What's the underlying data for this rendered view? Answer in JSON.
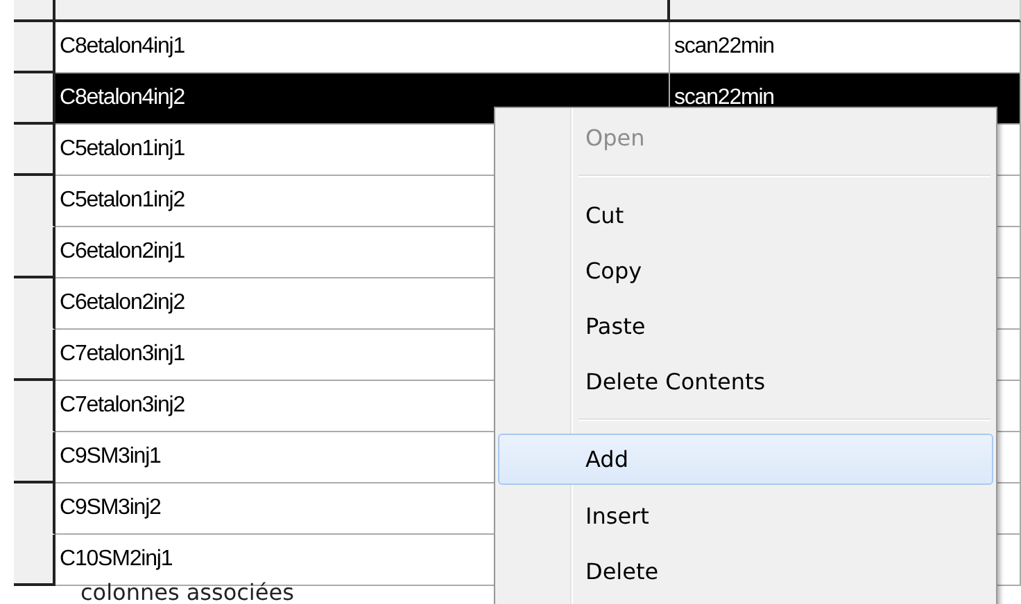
{
  "grid": {
    "rows": [
      {
        "cells": [
          "C8etalon4inj1",
          "scan22min"
        ],
        "selected": false
      },
      {
        "cells": [
          "C8etalon4inj2",
          "scan22min"
        ],
        "selected": true
      },
      {
        "cells": [
          "C5etalon1inj1"
        ],
        "selected": false
      },
      {
        "cells": [
          "C5etalon1inj2"
        ],
        "selected": false
      },
      {
        "cells": [
          "C6etalon2inj1"
        ],
        "selected": false
      },
      {
        "cells": [
          "C6etalon2inj2"
        ],
        "selected": false
      },
      {
        "cells": [
          "C7etalon3inj1"
        ],
        "selected": false
      },
      {
        "cells": [
          "C7etalon3inj2"
        ],
        "selected": false
      },
      {
        "cells": [
          "C9SM3inj1"
        ],
        "selected": false
      },
      {
        "cells": [
          "C9SM3inj2"
        ],
        "selected": false
      },
      {
        "cells": [
          "C10SM2inj1"
        ],
        "selected": false
      }
    ]
  },
  "context_menu": {
    "items": [
      {
        "kind": "item",
        "label": "Open",
        "disabled": true,
        "selected": false
      },
      {
        "kind": "separator"
      },
      {
        "kind": "item",
        "label": "Cut",
        "disabled": false,
        "selected": false
      },
      {
        "kind": "item",
        "label": "Copy",
        "disabled": false,
        "selected": false
      },
      {
        "kind": "item",
        "label": "Paste",
        "disabled": false,
        "selected": false
      },
      {
        "kind": "item",
        "label": "Delete Contents",
        "disabled": false,
        "selected": false
      },
      {
        "kind": "separator"
      },
      {
        "kind": "item",
        "label": "Add",
        "disabled": false,
        "selected": true
      },
      {
        "kind": "item",
        "label": "Insert",
        "disabled": false,
        "selected": false
      },
      {
        "kind": "item",
        "label": "Delete",
        "disabled": false,
        "selected": false
      }
    ]
  },
  "caption": "colonnes associées"
}
